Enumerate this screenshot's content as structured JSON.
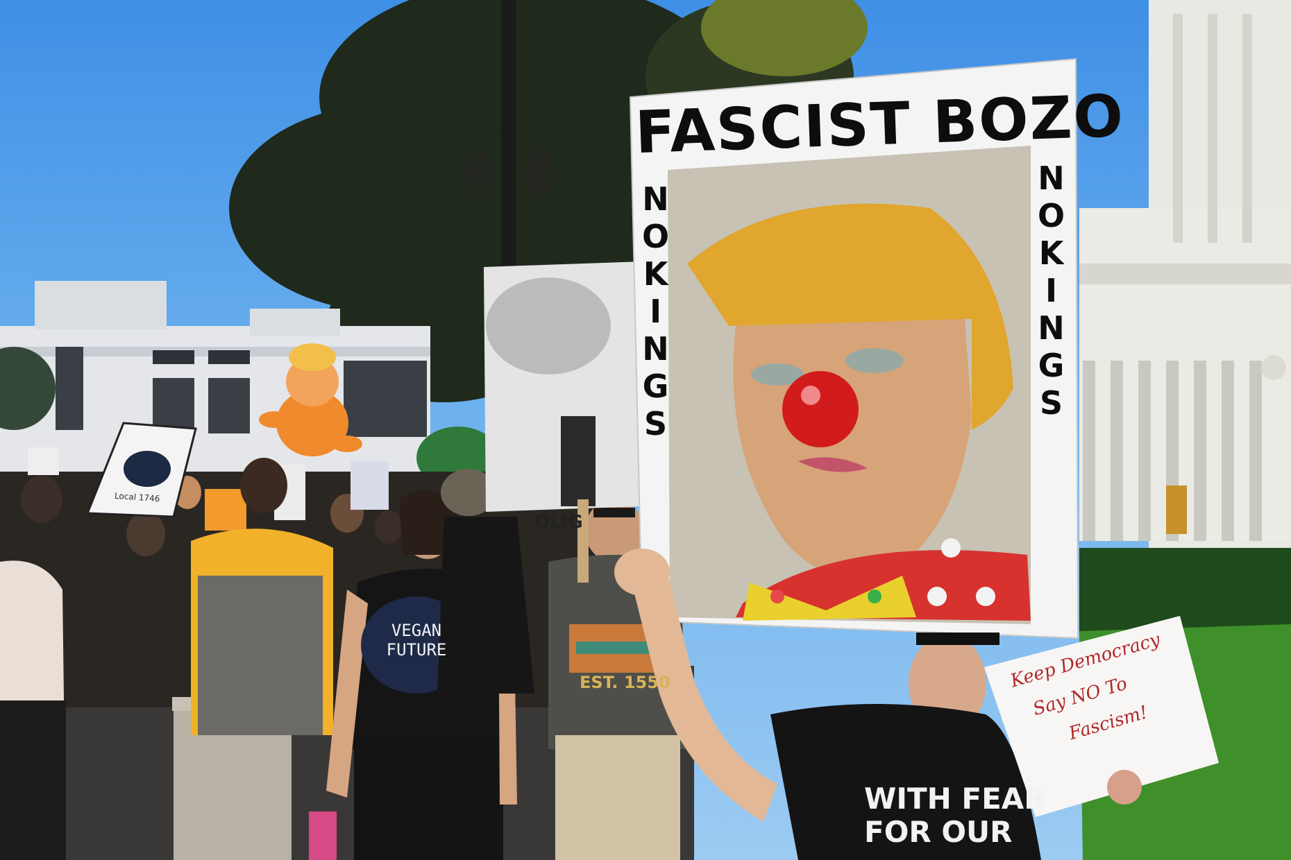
{
  "scene": {
    "main_sign": {
      "title": "FASCIST BOZO",
      "left_vertical": [
        "N",
        "O",
        "K",
        "I",
        "N",
        "G",
        "S"
      ],
      "right_vertical": [
        "N",
        "O",
        "K",
        "I",
        "N",
        "G",
        "S"
      ]
    },
    "shirts": {
      "center_line1": "VEGAN",
      "center_line2": "FUTURE",
      "right_line1": "WITH FEAR",
      "right_line2": "FOR OUR",
      "est": "EST. 1550"
    },
    "hand_sign": {
      "line1": "Keep Democracy",
      "line2": "Say  NO To",
      "line3": "Fascism!"
    },
    "union_sign": {
      "text": "Local 1746"
    },
    "small_sign": {
      "text": "OLIG"
    }
  }
}
